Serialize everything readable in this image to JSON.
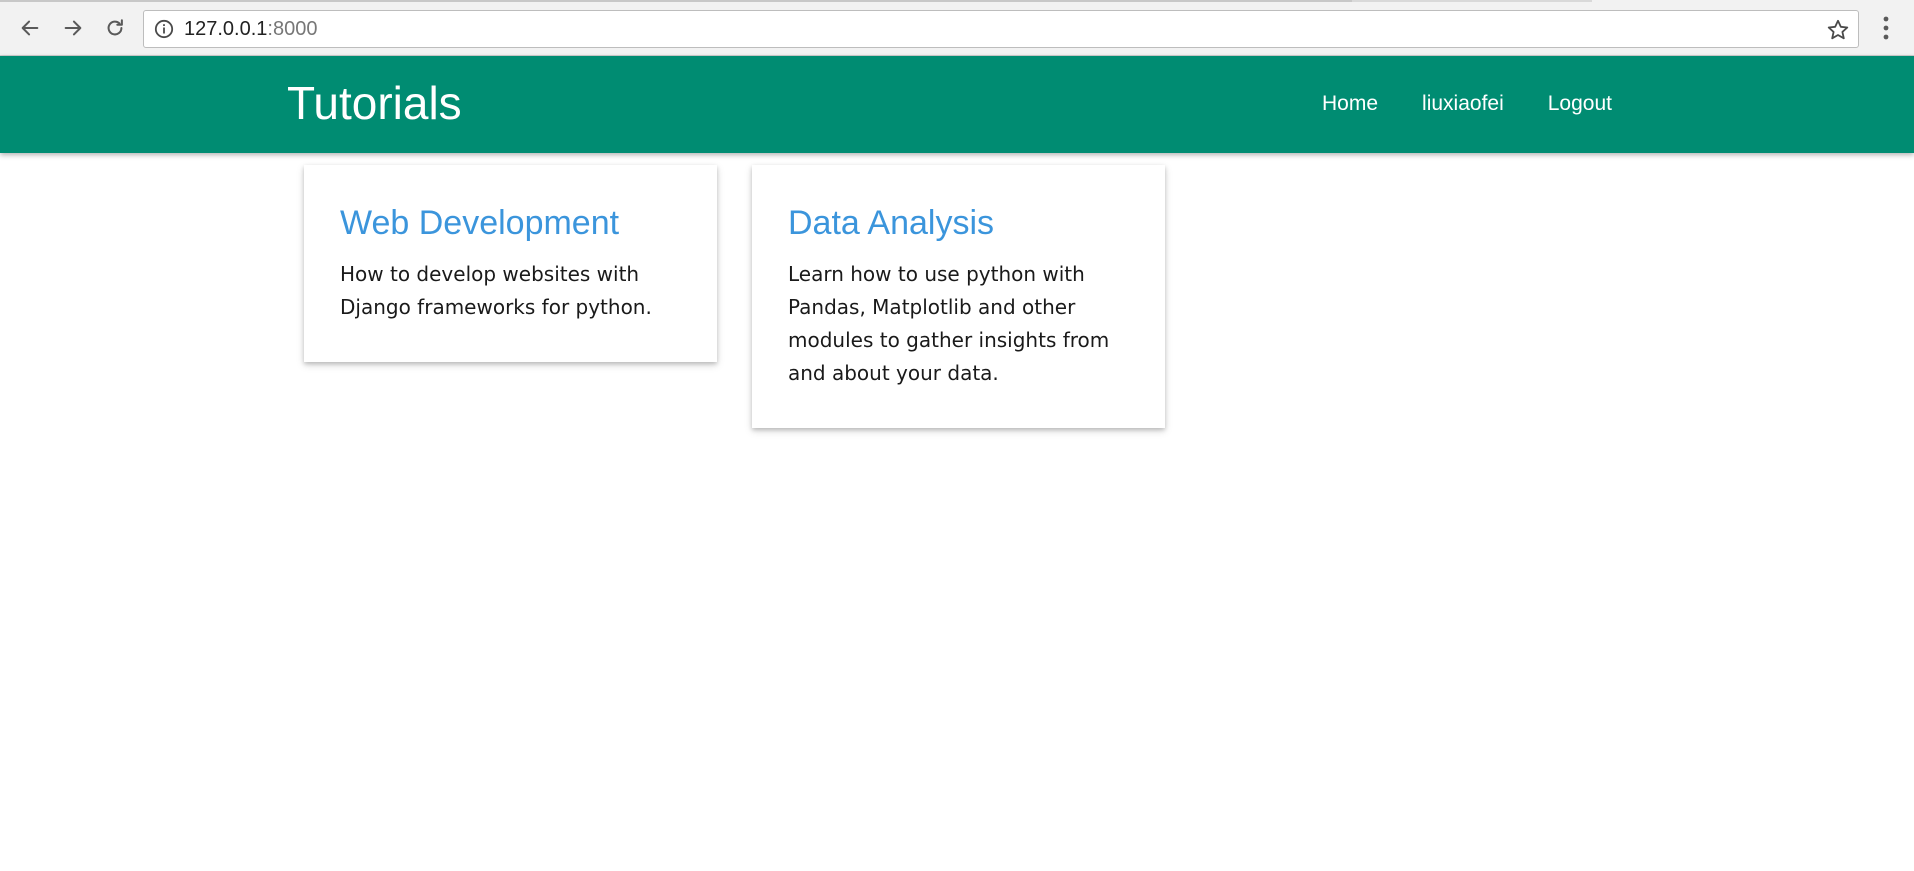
{
  "browser": {
    "url_host": "127.0.0.1",
    "url_port": ":8000",
    "icons": {
      "back": "arrow-left-icon",
      "forward": "arrow-right-icon",
      "reload": "reload-icon",
      "info": "info-icon",
      "bookmark": "star-icon",
      "menu": "vertical-dots-icon"
    }
  },
  "header": {
    "brand": "Tutorials",
    "background_color": "#008c72",
    "nav": {
      "home": "Home",
      "user": "liuxiaofei",
      "logout": "Logout"
    }
  },
  "cards": [
    {
      "title": "Web Development",
      "text": "How to develop websites with Django frameworks for python."
    },
    {
      "title": "Data Analysis",
      "text": "Learn how to use python with Pandas, Matplotlib and other modules to gather insights from and about your data."
    }
  ],
  "colors": {
    "card_title": "#3b95dc",
    "card_text": "#1a1a1a"
  }
}
